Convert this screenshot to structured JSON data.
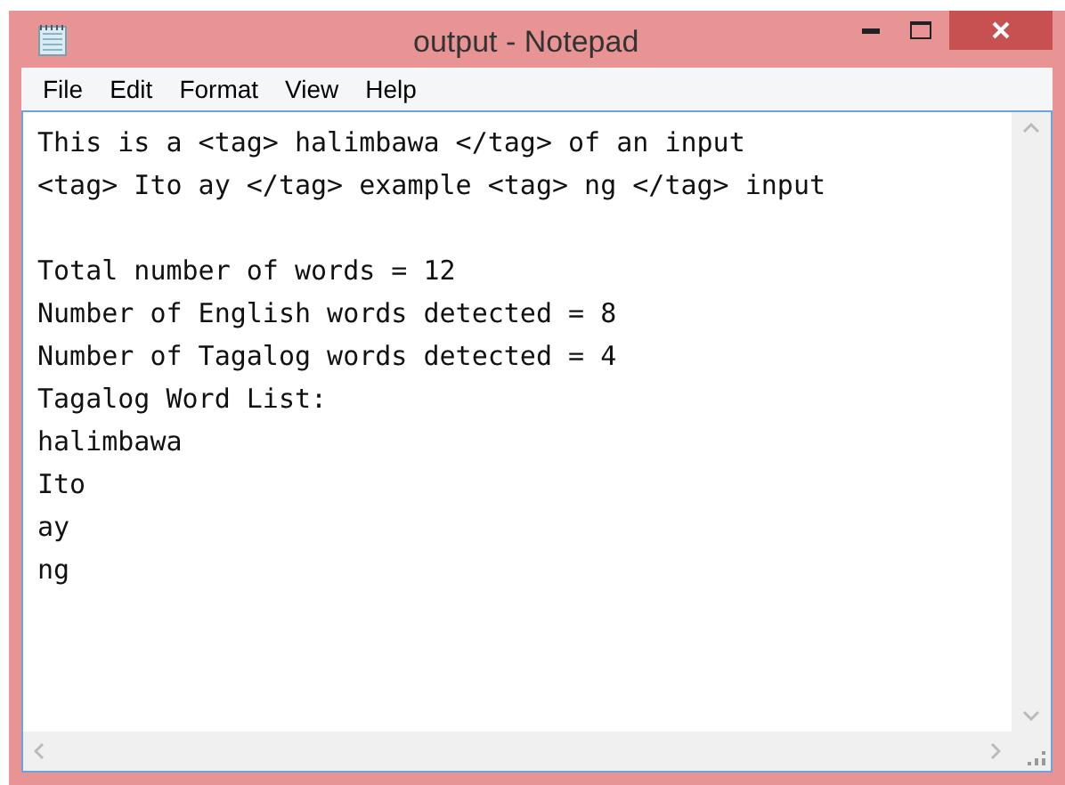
{
  "window": {
    "title": "output - Notepad"
  },
  "menu": [
    "File",
    "Edit",
    "Format",
    "View",
    "Help"
  ],
  "editor": {
    "input_lines": [
      "This is a <tag> halimbawa </tag> of an input",
      "<tag> Ito ay </tag> example <tag> ng </tag> input"
    ],
    "output_lines": [
      "Total number of words = 12",
      "Number of English words detected = 8",
      "Number of Tagalog words detected = 4",
      "Tagalog Word List:",
      "halimbawa",
      "Ito",
      "ay",
      "ng"
    ]
  }
}
